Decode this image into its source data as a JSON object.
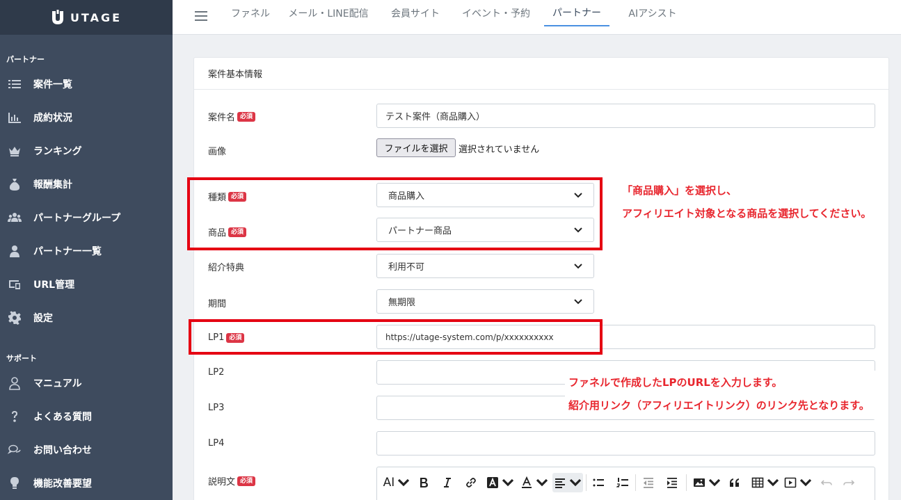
{
  "brand": {
    "name": "UTAGE"
  },
  "sidebar": {
    "section_partner": "パートナー",
    "items": [
      {
        "label": "案件一覧",
        "icon": "list-icon"
      },
      {
        "label": "成約状況",
        "icon": "bar-chart-icon"
      },
      {
        "label": "ランキング",
        "icon": "crown-icon"
      },
      {
        "label": "報酬集計",
        "icon": "money-bag-icon"
      },
      {
        "label": "パートナーグループ",
        "icon": "users-icon"
      },
      {
        "label": "パートナー一覧",
        "icon": "user-icon"
      },
      {
        "label": "URL管理",
        "icon": "devices-icon"
      },
      {
        "label": "設定",
        "icon": "gear-icon"
      }
    ],
    "section_support": "サポート",
    "support_items": [
      {
        "label": "マニュアル",
        "icon": "person-outline-icon"
      },
      {
        "label": "よくある質問",
        "icon": "question-icon"
      },
      {
        "label": "お問い合わせ",
        "icon": "chat-icon"
      },
      {
        "label": "機能改善要望",
        "icon": "lightbulb-icon"
      }
    ]
  },
  "topnav": {
    "tabs": [
      {
        "label": "ファネル"
      },
      {
        "label": "メール・LINE配信"
      },
      {
        "label": "会員サイト"
      },
      {
        "label": "イベント・予約"
      },
      {
        "label": "パートナー"
      },
      {
        "label": "AIアシスト"
      }
    ],
    "active_tab": "パートナー"
  },
  "form": {
    "header": "案件基本情報",
    "required_badge": "必須",
    "name_label": "案件名",
    "name_value": "テスト案件（商品購入）",
    "image_label": "画像",
    "file_button": "ファイルを選択",
    "file_status": "選択されていません",
    "type_label": "種類",
    "type_value": "商品購入",
    "product_label": "商品",
    "product_value": "パートナー商品",
    "benefit_label": "紹介特典",
    "benefit_value": "利用不可",
    "period_label": "期間",
    "period_value": "無期限",
    "lp1_label": "LP1",
    "lp1_value": "https://utage-system.com/p/xxxxxxxxxx",
    "lp2_label": "LP2",
    "lp3_label": "LP3",
    "lp4_label": "LP4",
    "description_label": "説明文"
  },
  "editor_toolbar": {
    "font_size_label": "AI",
    "buttons": [
      "font-size-icon",
      "bold-icon",
      "italic-icon",
      "link-icon",
      "highlight-icon",
      "font-color-icon",
      "align-icon",
      "bullet-list-icon",
      "numbered-list-icon",
      "outdent-icon",
      "indent-icon",
      "image-icon",
      "quote-icon",
      "table-icon",
      "media-icon",
      "undo-icon",
      "redo-icon"
    ]
  },
  "annotations": {
    "type_note_1": "「商品購入」を選択し、",
    "type_note_2": "アフィリエイト対象となる商品を選択してください。",
    "lp_note_1": "ファネルで作成したLPのURLを入力します。",
    "lp_note_2": "紹介用リンク（アフィリエイトリンク）のリンク先となります。"
  },
  "colors": {
    "sidebar_bg": "#3e4b5e",
    "logo_bg": "#2f3a4a",
    "accent": "#4a90e2",
    "required": "#dc3545",
    "annotation": "#e8262e"
  }
}
